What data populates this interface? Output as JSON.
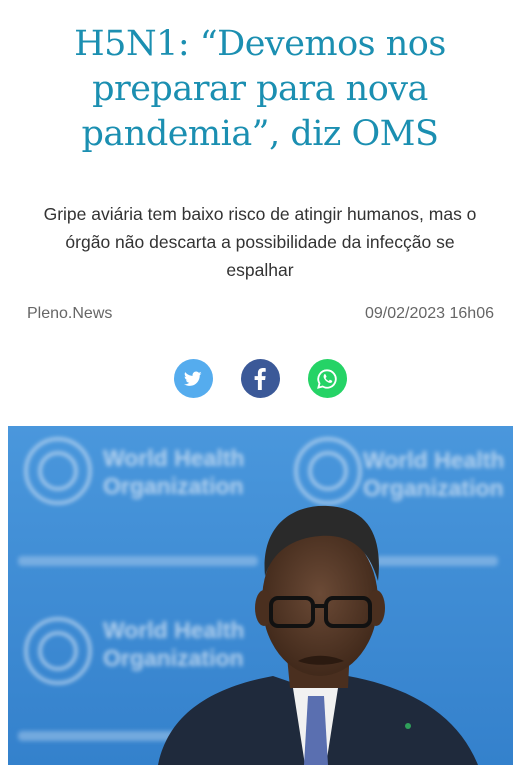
{
  "article": {
    "headline": "H5N1: “Devemos nos preparar para nova pandemia”, diz OMS",
    "subtitle": "Gripe aviária tem baixo risco de atingir humanos, mas o órgão não descarta a possibilidade da infecção se espalhar",
    "source": "Pleno.News",
    "datetime": "09/02/2023 16h06"
  },
  "share": {
    "buttons": [
      {
        "icon": "twitter-icon",
        "color": "#55acee"
      },
      {
        "icon": "facebook-icon",
        "color": "#3b5998"
      },
      {
        "icon": "whatsapp-icon",
        "color": "#25d366"
      }
    ]
  },
  "photo": {
    "backdrop_logo_text": [
      "World Health",
      "Organization"
    ],
    "backdrop_color": "#3d8fd6"
  },
  "colors": {
    "headline": "#1b8fb1",
    "text": "#333333",
    "meta": "#666666"
  }
}
